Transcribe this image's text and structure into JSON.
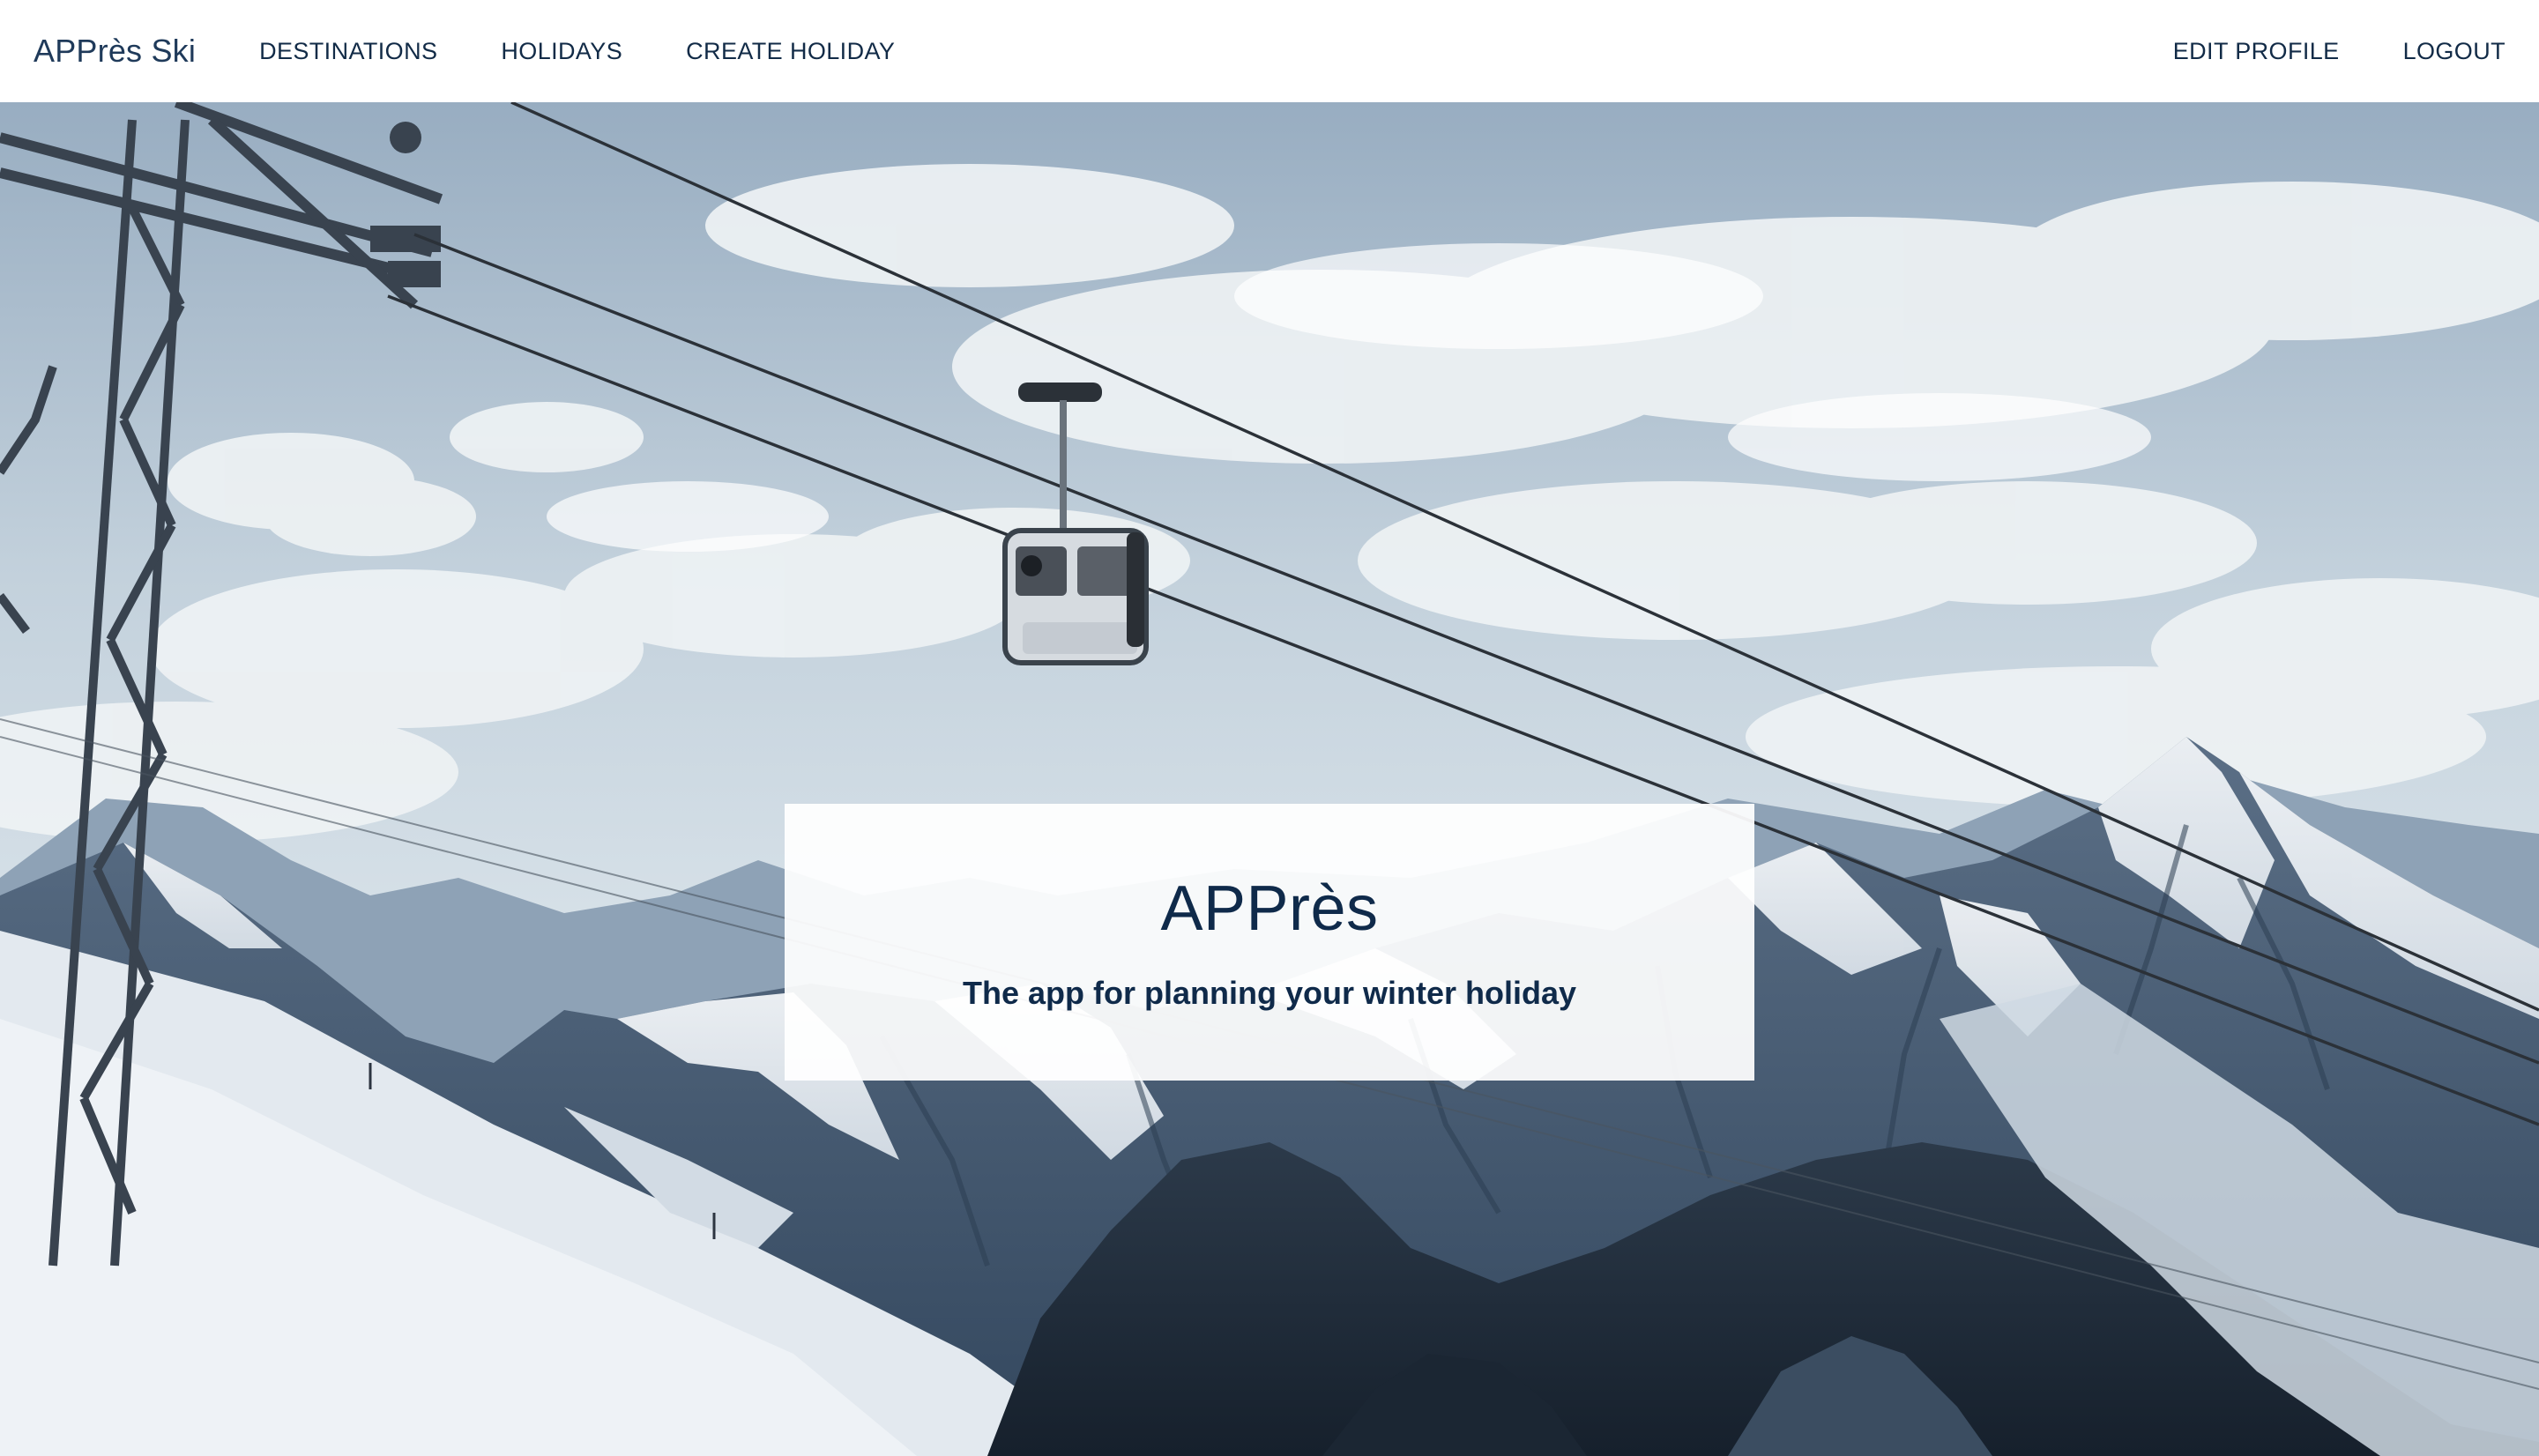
{
  "navbar": {
    "brand": "APPrès Ski",
    "left_links": [
      "DESTINATIONS",
      "HOLIDAYS",
      "CREATE HOLIDAY"
    ],
    "right_links": [
      "EDIT PROFILE",
      "LOGOUT"
    ]
  },
  "hero": {
    "title": "APPrès",
    "subtitle": "The app for planning your winter holiday"
  },
  "colors": {
    "nav_text": "#122b47",
    "brand_text": "#1f3a5a",
    "card_text": "#0f2a4a",
    "card_background": "#ffffff"
  },
  "icons": {
    "background_image": "ski-lift-gondola-mountains"
  }
}
